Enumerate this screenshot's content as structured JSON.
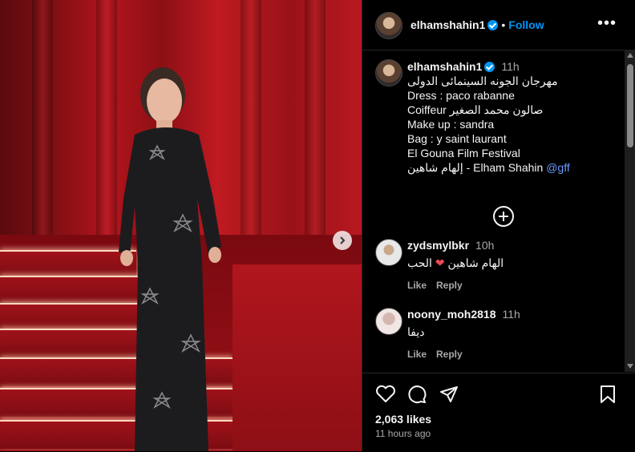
{
  "post": {
    "username": "elhamshahin1",
    "follow_label": "Follow",
    "dot": "•",
    "more_label": "•••"
  },
  "caption": {
    "username": "elhamshahin1",
    "time": "11h",
    "lines": [
      "مهرجان الجونه السينمائى الدولى",
      "Dress : paco rabanne",
      "Coiffeur صالون محمد الصغير",
      "Make up : sandra",
      "Bag : y saint laurant",
      "El Gouna Film Festival",
      "إلهام شاهين - Elham Shahin"
    ],
    "mention": "@gff"
  },
  "comments": [
    {
      "username": "zydsmylbkr",
      "time": "10h",
      "text_before": "الهام شاهين",
      "text_after": "الحب",
      "heart": "❤",
      "like": "Like",
      "reply": "Reply"
    },
    {
      "username": "noony_moh2818",
      "time": "11h",
      "text": "ديفا",
      "like": "Like",
      "reply": "Reply"
    }
  ],
  "footer": {
    "likes": "2,063 likes",
    "ago": "11 hours ago"
  },
  "colors": {
    "accent": "#0095f6",
    "heart": "#ed4956"
  }
}
